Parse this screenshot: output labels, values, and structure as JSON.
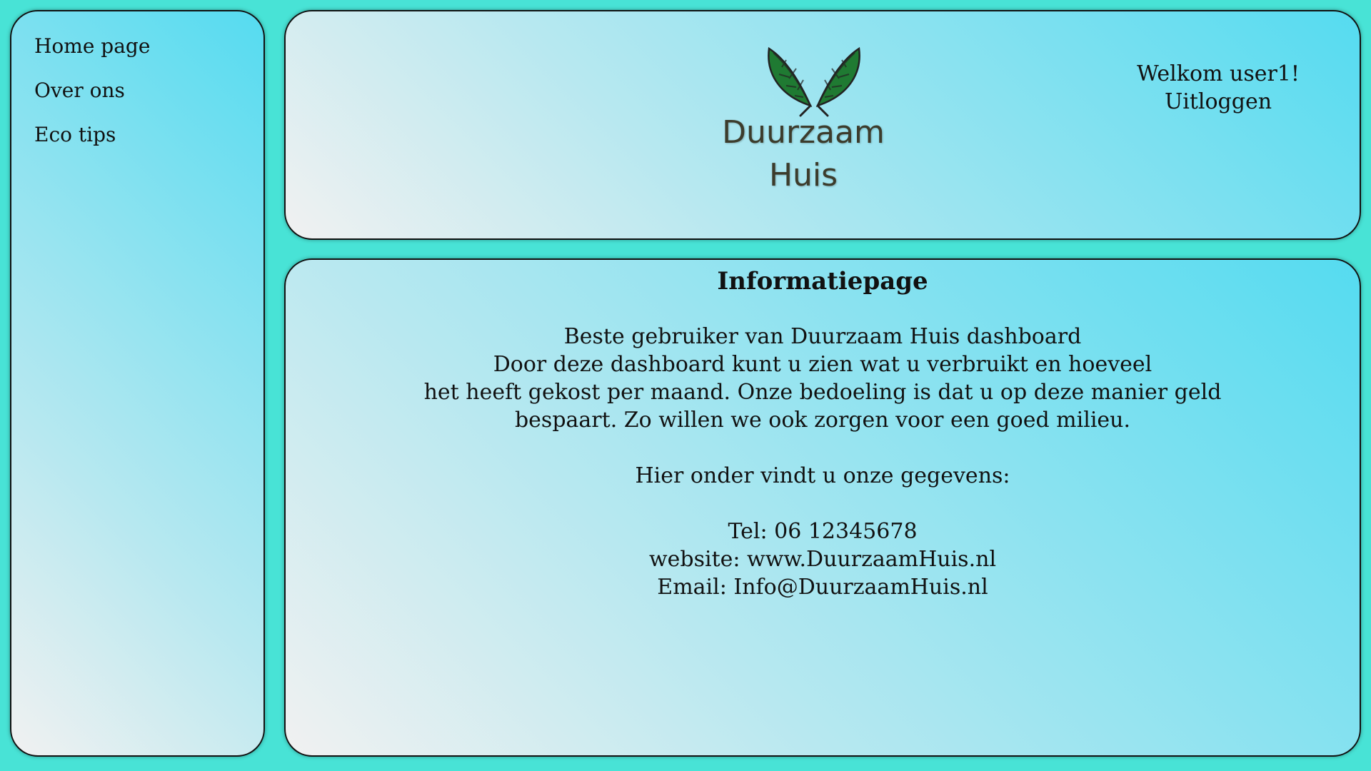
{
  "sidebar": {
    "items": [
      {
        "label": "Home page"
      },
      {
        "label": "Over ons"
      },
      {
        "label": "Eco tips"
      }
    ]
  },
  "header": {
    "logo": {
      "line1": "Duurzaam",
      "line2": "Huis",
      "icon": "leaves-icon"
    },
    "welcome": "Welkom user1!",
    "logout": "Uitloggen"
  },
  "main": {
    "title": "Informatiepage",
    "paragraph": [
      "Beste gebruiker van Duurzaam Huis dashboard",
      "Door deze dashboard kunt u zien wat u verbruikt en hoeveel",
      "het heeft gekost per maand. Onze bedoeling is dat u op deze manier geld",
      "bespaart. Zo willen we ook zorgen voor een goed milieu."
    ],
    "contact_intro": "Hier onder vindt u onze gegevens:",
    "contact": {
      "tel": "Tel: 06 12345678",
      "website": "website: www.DuurzaamHuis.nl",
      "email": "Email: Info@DuurzaamHuis.nl"
    }
  },
  "colors": {
    "background": "#48e3d6",
    "panel_gradient_start": "#f1f1f1",
    "panel_gradient_end": "#55dbf0",
    "leaf_green": "#1f7a32"
  }
}
